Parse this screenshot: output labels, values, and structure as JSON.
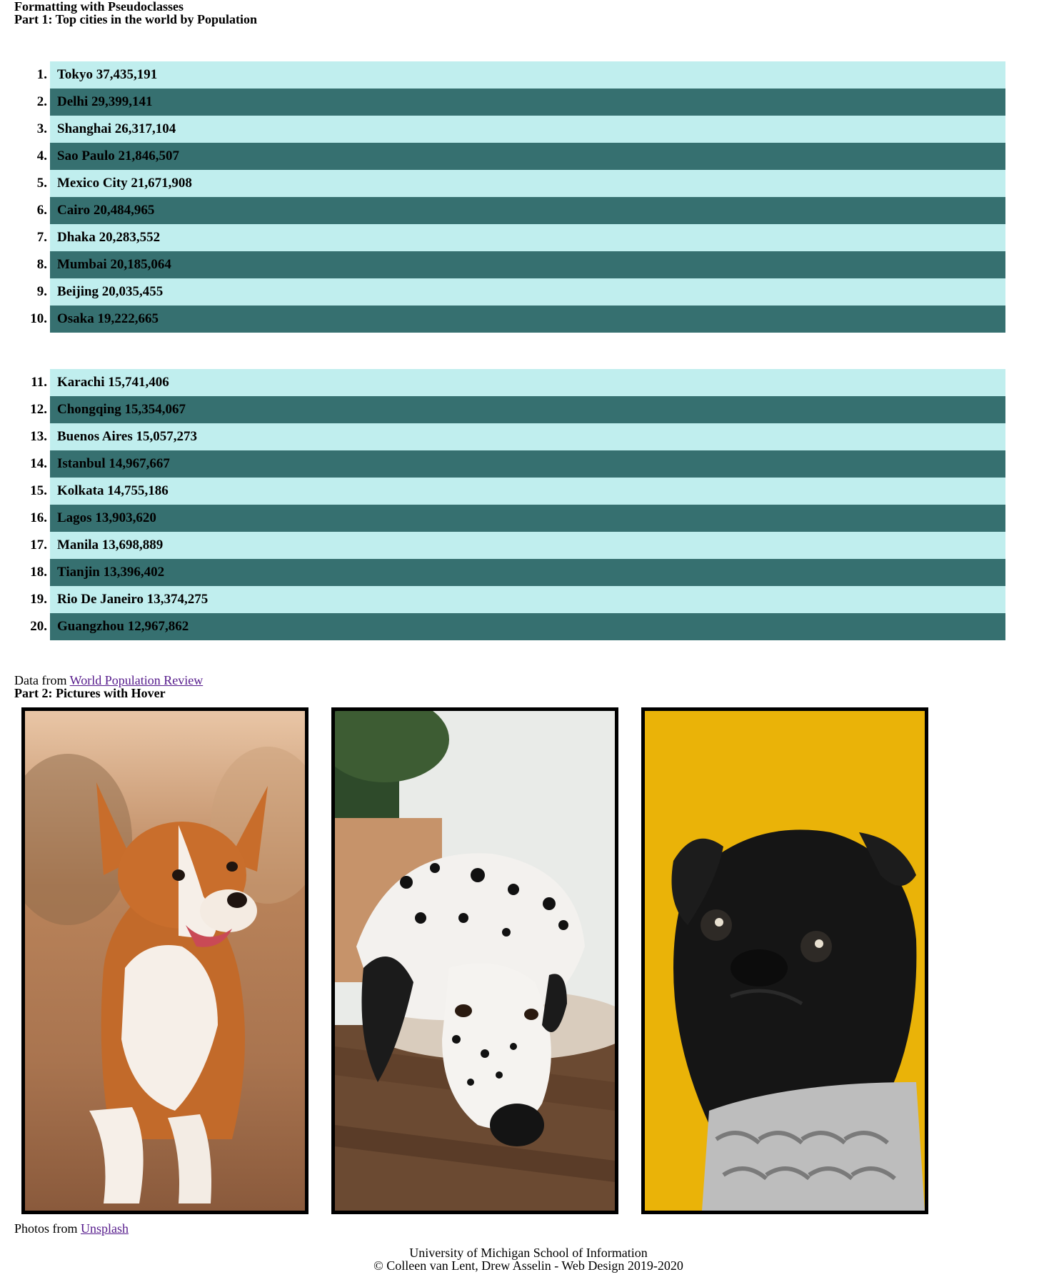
{
  "page": {
    "title": "Formatting with Pseudoclasses",
    "part1_heading": "Part 1: Top cities in the world by Population",
    "part2_heading": "Part 2: Pictures with Hover"
  },
  "cities_group1": [
    {
      "rank": "1.",
      "text": "Tokyo 37,435,191"
    },
    {
      "rank": "2.",
      "text": "Delhi 29,399,141"
    },
    {
      "rank": "3.",
      "text": "Shanghai 26,317,104"
    },
    {
      "rank": "4.",
      "text": "Sao Paulo 21,846,507"
    },
    {
      "rank": "5.",
      "text": "Mexico City 21,671,908"
    },
    {
      "rank": "6.",
      "text": "Cairo 20,484,965"
    },
    {
      "rank": "7.",
      "text": "Dhaka 20,283,552"
    },
    {
      "rank": "8.",
      "text": "Mumbai 20,185,064"
    },
    {
      "rank": "9.",
      "text": "Beijing 20,035,455"
    },
    {
      "rank": "10.",
      "text": "Osaka 19,222,665"
    }
  ],
  "cities_group2": [
    {
      "rank": "11.",
      "text": "Karachi 15,741,406"
    },
    {
      "rank": "12.",
      "text": "Chongqing 15,354,067"
    },
    {
      "rank": "13.",
      "text": "Buenos Aires 15,057,273"
    },
    {
      "rank": "14.",
      "text": "Istanbul 14,967,667"
    },
    {
      "rank": "15.",
      "text": "Kolkata 14,755,186"
    },
    {
      "rank": "16.",
      "text": "Lagos 13,903,620"
    },
    {
      "rank": "17.",
      "text": "Manila 13,698,889"
    },
    {
      "rank": "18.",
      "text": "Tianjin 13,396,402"
    },
    {
      "rank": "19.",
      "text": "Rio De Janeiro 13,374,275"
    },
    {
      "rank": "20.",
      "text": "Guangzhou 12,967,862"
    }
  ],
  "data_source": {
    "prefix": "Data from ",
    "link_text": "World Population Review"
  },
  "photos": [
    {
      "subject": "corgi"
    },
    {
      "subject": "dalmatian"
    },
    {
      "subject": "pug"
    }
  ],
  "photos_source": {
    "prefix": "Photos from ",
    "link_text": "Unsplash"
  },
  "footer": {
    "line1": "University of Michigan School of Information",
    "line2": "© Colleen van Lent, Drew Asselin - Web Design 2019-2020"
  },
  "colors": {
    "row_light": "#c0eeee",
    "row_dark": "#367070",
    "link_visited": "#551a8b",
    "pug_background": "#eab308"
  }
}
